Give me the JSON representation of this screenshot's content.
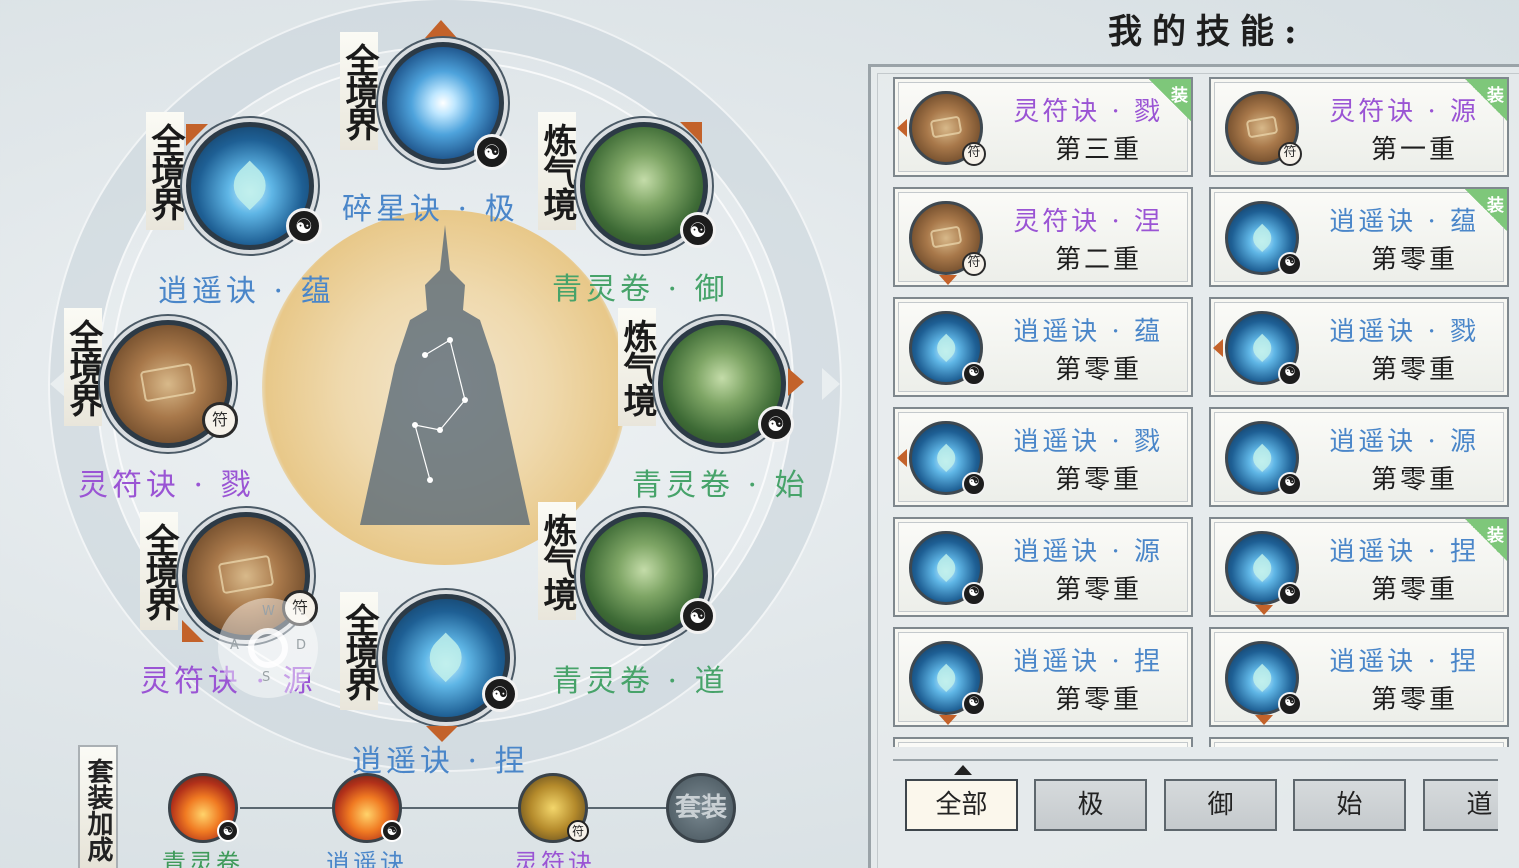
{
  "panel": {
    "title": "我的技能:"
  },
  "wheel": {
    "nodes": [
      {
        "realm": "全境界",
        "skill": "碎星诀 · 极",
        "color": "blue",
        "icon": "star-orb-icon"
      },
      {
        "realm": "炼气境",
        "skill": "青灵卷 · 御",
        "color": "green",
        "icon": "green-orb-icon"
      },
      {
        "realm": "炼气境",
        "skill": "青灵卷 · 始",
        "color": "green",
        "icon": "green-orb-icon"
      },
      {
        "realm": "炼气境",
        "skill": "青灵卷 · 道",
        "color": "green",
        "icon": "green-orb-icon"
      },
      {
        "realm": "全境界",
        "skill": "逍遥诀 · 捏",
        "color": "blue",
        "icon": "leaf-orb-icon"
      },
      {
        "realm": "全境界",
        "skill": "灵符诀 · 源",
        "color": "purple",
        "icon": "talisman-orb-icon"
      },
      {
        "realm": "全境界",
        "skill": "灵符诀 · 戮",
        "color": "purple",
        "icon": "talisman-orb-icon"
      },
      {
        "realm": "全境界",
        "skill": "逍遥诀 · 蕴",
        "color": "blue",
        "icon": "leaf-orb-icon"
      }
    ],
    "joystick": {
      "w": "W",
      "a": "A",
      "s": "S",
      "d": "D"
    }
  },
  "set_bonus": {
    "title": "套装加成",
    "items": [
      {
        "label": "青灵卷",
        "icon": "fire-icon"
      },
      {
        "label": "逍遥诀",
        "icon": "fire-icon"
      },
      {
        "label": "灵符诀",
        "icon": "scroll-icon"
      },
      {
        "label": "套装",
        "icon": "seal-icon"
      }
    ]
  },
  "cards": [
    {
      "name": "灵符诀 · 戮",
      "level": "第三重",
      "color": "purple",
      "equipped": true,
      "equip_label": "装"
    },
    {
      "name": "灵符诀 · 源",
      "level": "第一重",
      "color": "purple",
      "equipped": true,
      "equip_label": "装"
    },
    {
      "name": "灵符诀 · 涅",
      "level": "第二重",
      "color": "purple",
      "equipped": false
    },
    {
      "name": "逍遥诀 · 蕴",
      "level": "第零重",
      "color": "blue",
      "equipped": true,
      "equip_label": "装"
    },
    {
      "name": "逍遥诀 · 蕴",
      "level": "第零重",
      "color": "blue",
      "equipped": false
    },
    {
      "name": "逍遥诀 · 戮",
      "level": "第零重",
      "color": "blue",
      "equipped": false
    },
    {
      "name": "逍遥诀 · 戮",
      "level": "第零重",
      "color": "blue",
      "equipped": false
    },
    {
      "name": "逍遥诀 · 源",
      "level": "第零重",
      "color": "blue",
      "equipped": false
    },
    {
      "name": "逍遥诀 · 源",
      "level": "第零重",
      "color": "blue",
      "equipped": false
    },
    {
      "name": "逍遥诀 · 捏",
      "level": "第零重",
      "color": "blue",
      "equipped": true,
      "equip_label": "装"
    },
    {
      "name": "逍遥诀 · 捏",
      "level": "第零重",
      "color": "blue",
      "equipped": false
    },
    {
      "name": "逍遥诀 · 捏",
      "level": "第零重",
      "color": "blue",
      "equipped": false
    }
  ],
  "tabs": [
    "全部",
    "极",
    "御",
    "始",
    "道"
  ],
  "colors": {
    "purple": "#9a54d4",
    "blue": "#4a86c9",
    "green": "#47a36a"
  }
}
